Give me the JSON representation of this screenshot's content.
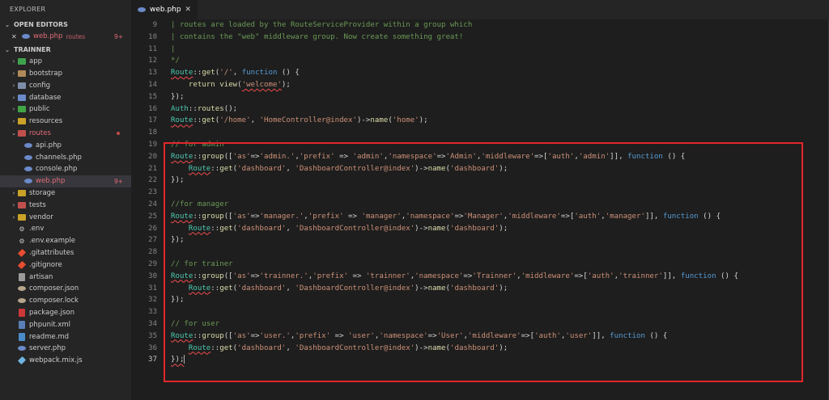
{
  "sidebar": {
    "title": "EXPLORER",
    "open_editors_label": "OPEN EDITORS",
    "open_editor": {
      "close": "✕",
      "name": "web.php",
      "folder": "routes",
      "badge": "9+"
    },
    "project_label": "TRAINNER",
    "items": [
      {
        "label": "app",
        "type": "folder",
        "icon_color": "#3fa34d",
        "depth": 0,
        "chevron": "›"
      },
      {
        "label": "bootstrap",
        "type": "folder",
        "icon_color": "#b08a5a",
        "depth": 0,
        "chevron": "›"
      },
      {
        "label": "config",
        "type": "folder",
        "icon_color": "#7c8fa8",
        "depth": 0,
        "chevron": "›"
      },
      {
        "label": "database",
        "type": "folder",
        "icon_color": "#6b8ac9",
        "depth": 0,
        "chevron": "›"
      },
      {
        "label": "public",
        "type": "folder",
        "icon_color": "#42a545",
        "depth": 0,
        "chevron": "›"
      },
      {
        "label": "resources",
        "type": "folder",
        "icon_color": "#c9a227",
        "depth": 0,
        "chevron": "›"
      },
      {
        "label": "routes",
        "type": "folder-open",
        "icon_color": "#c0504d",
        "depth": 0,
        "chevron": "⌄",
        "label_color": "#e06c75"
      },
      {
        "label": "api.php",
        "type": "php",
        "depth": 1
      },
      {
        "label": "channels.php",
        "type": "php",
        "depth": 1
      },
      {
        "label": "console.php",
        "type": "php",
        "depth": 1
      },
      {
        "label": "web.php",
        "type": "php",
        "depth": 1,
        "active": true,
        "badge": "9+",
        "label_color": "#e06c75"
      },
      {
        "label": "storage",
        "type": "folder",
        "icon_color": "#c9a227",
        "depth": 0,
        "chevron": "›"
      },
      {
        "label": "tests",
        "type": "folder",
        "icon_color": "#c0504d",
        "depth": 0,
        "chevron": "›"
      },
      {
        "label": "vendor",
        "type": "folder",
        "icon_color": "#c9a227",
        "depth": 0,
        "chevron": "›"
      },
      {
        "label": ".env",
        "type": "gear",
        "depth": 0
      },
      {
        "label": ".env.example",
        "type": "gear",
        "depth": 0
      },
      {
        "label": ".gitattributes",
        "type": "git",
        "depth": 0
      },
      {
        "label": ".gitignore",
        "type": "git",
        "depth": 0
      },
      {
        "label": "artisan",
        "type": "plain",
        "depth": 0
      },
      {
        "label": "composer.json",
        "type": "composer",
        "depth": 0
      },
      {
        "label": "composer.lock",
        "type": "composer",
        "depth": 0
      },
      {
        "label": "package.json",
        "type": "json",
        "depth": 0
      },
      {
        "label": "phpunit.xml",
        "type": "xml",
        "depth": 0
      },
      {
        "label": "readme.md",
        "type": "md",
        "depth": 0
      },
      {
        "label": "server.php",
        "type": "php",
        "depth": 0
      },
      {
        "label": "webpack.mix.js",
        "type": "js",
        "depth": 0
      }
    ]
  },
  "tab": {
    "name": "web.php",
    "close": "✕"
  },
  "colors": {
    "comment": "#6a9955",
    "class": "#4ec9b0",
    "func": "#dcdcaa",
    "string": "#ce9178",
    "keyword": "#569cd6",
    "plain": "#d4d4d4",
    "highlight_border": "#e3262b"
  },
  "editor": {
    "lines": [
      {
        "n": "9",
        "tokens": [
          [
            "comment",
            "| routes are loaded by the RouteServiceProvider within a group which"
          ]
        ]
      },
      {
        "n": "10",
        "tokens": [
          [
            "comment",
            "| contains the \"web\" middleware group. Now create something great!"
          ]
        ]
      },
      {
        "n": "11",
        "tokens": [
          [
            "comment",
            "|"
          ]
        ]
      },
      {
        "n": "12",
        "tokens": [
          [
            "comment",
            "*/"
          ]
        ]
      },
      {
        "n": "13",
        "tokens": [
          [
            "class",
            "Route",
            "sq"
          ],
          [
            "plain",
            "::"
          ],
          [
            "func",
            "get"
          ],
          [
            "plain",
            "("
          ],
          [
            "string",
            "'/'"
          ],
          [
            "plain",
            ", "
          ],
          [
            "keyword",
            "function"
          ],
          [
            "plain",
            " () {"
          ]
        ]
      },
      {
        "n": "14",
        "tokens": [
          [
            "plain",
            "    "
          ],
          [
            "func",
            "return"
          ],
          [
            "plain",
            " "
          ],
          [
            "func",
            "view"
          ],
          [
            "plain",
            "("
          ],
          [
            "string",
            "'welcome'",
            "sq"
          ],
          [
            "plain",
            ");"
          ]
        ]
      },
      {
        "n": "15",
        "tokens": [
          [
            "plain",
            "});"
          ]
        ]
      },
      {
        "n": "16",
        "tokens": [
          [
            "class",
            "Auth"
          ],
          [
            "plain",
            "::"
          ],
          [
            "func",
            "routes"
          ],
          [
            "plain",
            "();"
          ]
        ]
      },
      {
        "n": "17",
        "tokens": [
          [
            "class",
            "Route",
            "sq"
          ],
          [
            "plain",
            "::"
          ],
          [
            "func",
            "get"
          ],
          [
            "plain",
            "("
          ],
          [
            "string",
            "'/home'"
          ],
          [
            "plain",
            ", "
          ],
          [
            "string",
            "'HomeController@index'"
          ],
          [
            "plain",
            ")->"
          ],
          [
            "func",
            "name"
          ],
          [
            "plain",
            "("
          ],
          [
            "string",
            "'home'"
          ],
          [
            "plain",
            ");"
          ]
        ]
      },
      {
        "n": "18",
        "tokens": []
      },
      {
        "n": "19",
        "tokens": [
          [
            "comment",
            "// for admin"
          ]
        ]
      },
      {
        "n": "20",
        "tokens": [
          [
            "class",
            "Route",
            "sq"
          ],
          [
            "plain",
            "::"
          ],
          [
            "func",
            "group"
          ],
          [
            "plain",
            "(["
          ],
          [
            "string",
            "'as'"
          ],
          [
            "plain",
            "=>"
          ],
          [
            "string",
            "'admin.'"
          ],
          [
            "plain",
            ","
          ],
          [
            "string",
            "'prefix'"
          ],
          [
            "plain",
            " => "
          ],
          [
            "string",
            "'admin'"
          ],
          [
            "plain",
            ","
          ],
          [
            "string",
            "'namespace'"
          ],
          [
            "plain",
            "=>"
          ],
          [
            "string",
            "'Admin'"
          ],
          [
            "plain",
            ","
          ],
          [
            "string",
            "'middleware'"
          ],
          [
            "plain",
            "=>["
          ],
          [
            "string",
            "'auth'"
          ],
          [
            "plain",
            ","
          ],
          [
            "string",
            "'admin'"
          ],
          [
            "plain",
            "]], "
          ],
          [
            "keyword",
            "function"
          ],
          [
            "plain",
            " () {"
          ]
        ]
      },
      {
        "n": "21",
        "tokens": [
          [
            "plain",
            "    "
          ],
          [
            "class",
            "Route",
            "sq"
          ],
          [
            "plain",
            "::"
          ],
          [
            "func",
            "get"
          ],
          [
            "plain",
            "("
          ],
          [
            "string",
            "'dashboard'"
          ],
          [
            "plain",
            ", "
          ],
          [
            "string",
            "'DashboardController@index'"
          ],
          [
            "plain",
            ")->"
          ],
          [
            "func",
            "name"
          ],
          [
            "plain",
            "("
          ],
          [
            "string",
            "'dashboard'"
          ],
          [
            "plain",
            ");"
          ]
        ]
      },
      {
        "n": "22",
        "tokens": [
          [
            "plain",
            "});"
          ]
        ]
      },
      {
        "n": "23",
        "tokens": []
      },
      {
        "n": "24",
        "tokens": [
          [
            "comment",
            "//for manager"
          ]
        ]
      },
      {
        "n": "25",
        "tokens": [
          [
            "class",
            "Route",
            "sq"
          ],
          [
            "plain",
            "::"
          ],
          [
            "func",
            "group"
          ],
          [
            "plain",
            "(["
          ],
          [
            "string",
            "'as'"
          ],
          [
            "plain",
            "=>"
          ],
          [
            "string",
            "'manager.'"
          ],
          [
            "plain",
            ","
          ],
          [
            "string",
            "'prefix'"
          ],
          [
            "plain",
            " => "
          ],
          [
            "string",
            "'manager'"
          ],
          [
            "plain",
            ","
          ],
          [
            "string",
            "'namespace'"
          ],
          [
            "plain",
            "=>"
          ],
          [
            "string",
            "'Manager'"
          ],
          [
            "plain",
            ","
          ],
          [
            "string",
            "'middleware'"
          ],
          [
            "plain",
            "=>["
          ],
          [
            "string",
            "'auth'"
          ],
          [
            "plain",
            ","
          ],
          [
            "string",
            "'manager'"
          ],
          [
            "plain",
            "]], "
          ],
          [
            "keyword",
            "function"
          ],
          [
            "plain",
            " () {"
          ]
        ]
      },
      {
        "n": "26",
        "tokens": [
          [
            "plain",
            "    "
          ],
          [
            "class",
            "Route",
            "sq"
          ],
          [
            "plain",
            "::"
          ],
          [
            "func",
            "get"
          ],
          [
            "plain",
            "("
          ],
          [
            "string",
            "'dashboard'"
          ],
          [
            "plain",
            ", "
          ],
          [
            "string",
            "'DashboardController@index'"
          ],
          [
            "plain",
            ")->"
          ],
          [
            "func",
            "name"
          ],
          [
            "plain",
            "("
          ],
          [
            "string",
            "'dashboard'"
          ],
          [
            "plain",
            ");"
          ]
        ]
      },
      {
        "n": "27",
        "tokens": [
          [
            "plain",
            "});"
          ]
        ]
      },
      {
        "n": "28",
        "tokens": []
      },
      {
        "n": "29",
        "tokens": [
          [
            "comment",
            "// for trainer"
          ]
        ]
      },
      {
        "n": "30",
        "tokens": [
          [
            "class",
            "Route",
            "sq"
          ],
          [
            "plain",
            "::"
          ],
          [
            "func",
            "group"
          ],
          [
            "plain",
            "(["
          ],
          [
            "string",
            "'as'"
          ],
          [
            "plain",
            "=>"
          ],
          [
            "string",
            "'trainner.'"
          ],
          [
            "plain",
            ","
          ],
          [
            "string",
            "'prefix'"
          ],
          [
            "plain",
            " => "
          ],
          [
            "string",
            "'trainner'"
          ],
          [
            "plain",
            ","
          ],
          [
            "string",
            "'namespace'"
          ],
          [
            "plain",
            "=>"
          ],
          [
            "string",
            "'Trainner'"
          ],
          [
            "plain",
            ","
          ],
          [
            "string",
            "'middleware'"
          ],
          [
            "plain",
            "=>["
          ],
          [
            "string",
            "'auth'"
          ],
          [
            "plain",
            ","
          ],
          [
            "string",
            "'trainner'"
          ],
          [
            "plain",
            "]], "
          ],
          [
            "keyword",
            "function"
          ],
          [
            "plain",
            " () {"
          ]
        ]
      },
      {
        "n": "31",
        "tokens": [
          [
            "plain",
            "    "
          ],
          [
            "class",
            "Route",
            "sq"
          ],
          [
            "plain",
            "::"
          ],
          [
            "func",
            "get"
          ],
          [
            "plain",
            "("
          ],
          [
            "string",
            "'dashboard'"
          ],
          [
            "plain",
            ", "
          ],
          [
            "string",
            "'DashboardController@index'"
          ],
          [
            "plain",
            ")->"
          ],
          [
            "func",
            "name"
          ],
          [
            "plain",
            "("
          ],
          [
            "string",
            "'dashboard'"
          ],
          [
            "plain",
            ");"
          ]
        ]
      },
      {
        "n": "32",
        "tokens": [
          [
            "plain",
            "});"
          ]
        ]
      },
      {
        "n": "33",
        "tokens": []
      },
      {
        "n": "34",
        "tokens": [
          [
            "comment",
            "// for user"
          ]
        ]
      },
      {
        "n": "35",
        "tokens": [
          [
            "class",
            "Route",
            "sq"
          ],
          [
            "plain",
            "::"
          ],
          [
            "func",
            "group"
          ],
          [
            "plain",
            "(["
          ],
          [
            "string",
            "'as'"
          ],
          [
            "plain",
            "=>"
          ],
          [
            "string",
            "'user.'"
          ],
          [
            "plain",
            ","
          ],
          [
            "string",
            "'prefix'"
          ],
          [
            "plain",
            " => "
          ],
          [
            "string",
            "'user'"
          ],
          [
            "plain",
            ","
          ],
          [
            "string",
            "'namespace'"
          ],
          [
            "plain",
            "=>"
          ],
          [
            "string",
            "'User'"
          ],
          [
            "plain",
            ","
          ],
          [
            "string",
            "'middleware'"
          ],
          [
            "plain",
            "=>["
          ],
          [
            "string",
            "'auth'"
          ],
          [
            "plain",
            ","
          ],
          [
            "string",
            "'user'"
          ],
          [
            "plain",
            "]], "
          ],
          [
            "keyword",
            "function"
          ],
          [
            "plain",
            " () {"
          ]
        ]
      },
      {
        "n": "36",
        "tokens": [
          [
            "plain",
            "    "
          ],
          [
            "class",
            "Route",
            "sq"
          ],
          [
            "plain",
            "::"
          ],
          [
            "func",
            "get"
          ],
          [
            "plain",
            "("
          ],
          [
            "string",
            "'dashboard'"
          ],
          [
            "plain",
            ", "
          ],
          [
            "string",
            "'DashboardController@index'"
          ],
          [
            "plain",
            ")->"
          ],
          [
            "func",
            "name"
          ],
          [
            "plain",
            "("
          ],
          [
            "string",
            "'dashboard'"
          ],
          [
            "plain",
            ");"
          ]
        ]
      },
      {
        "n": "37",
        "tokens": [
          [
            "plain",
            "});",
            "sq"
          ]
        ],
        "cursor": true
      }
    ]
  }
}
